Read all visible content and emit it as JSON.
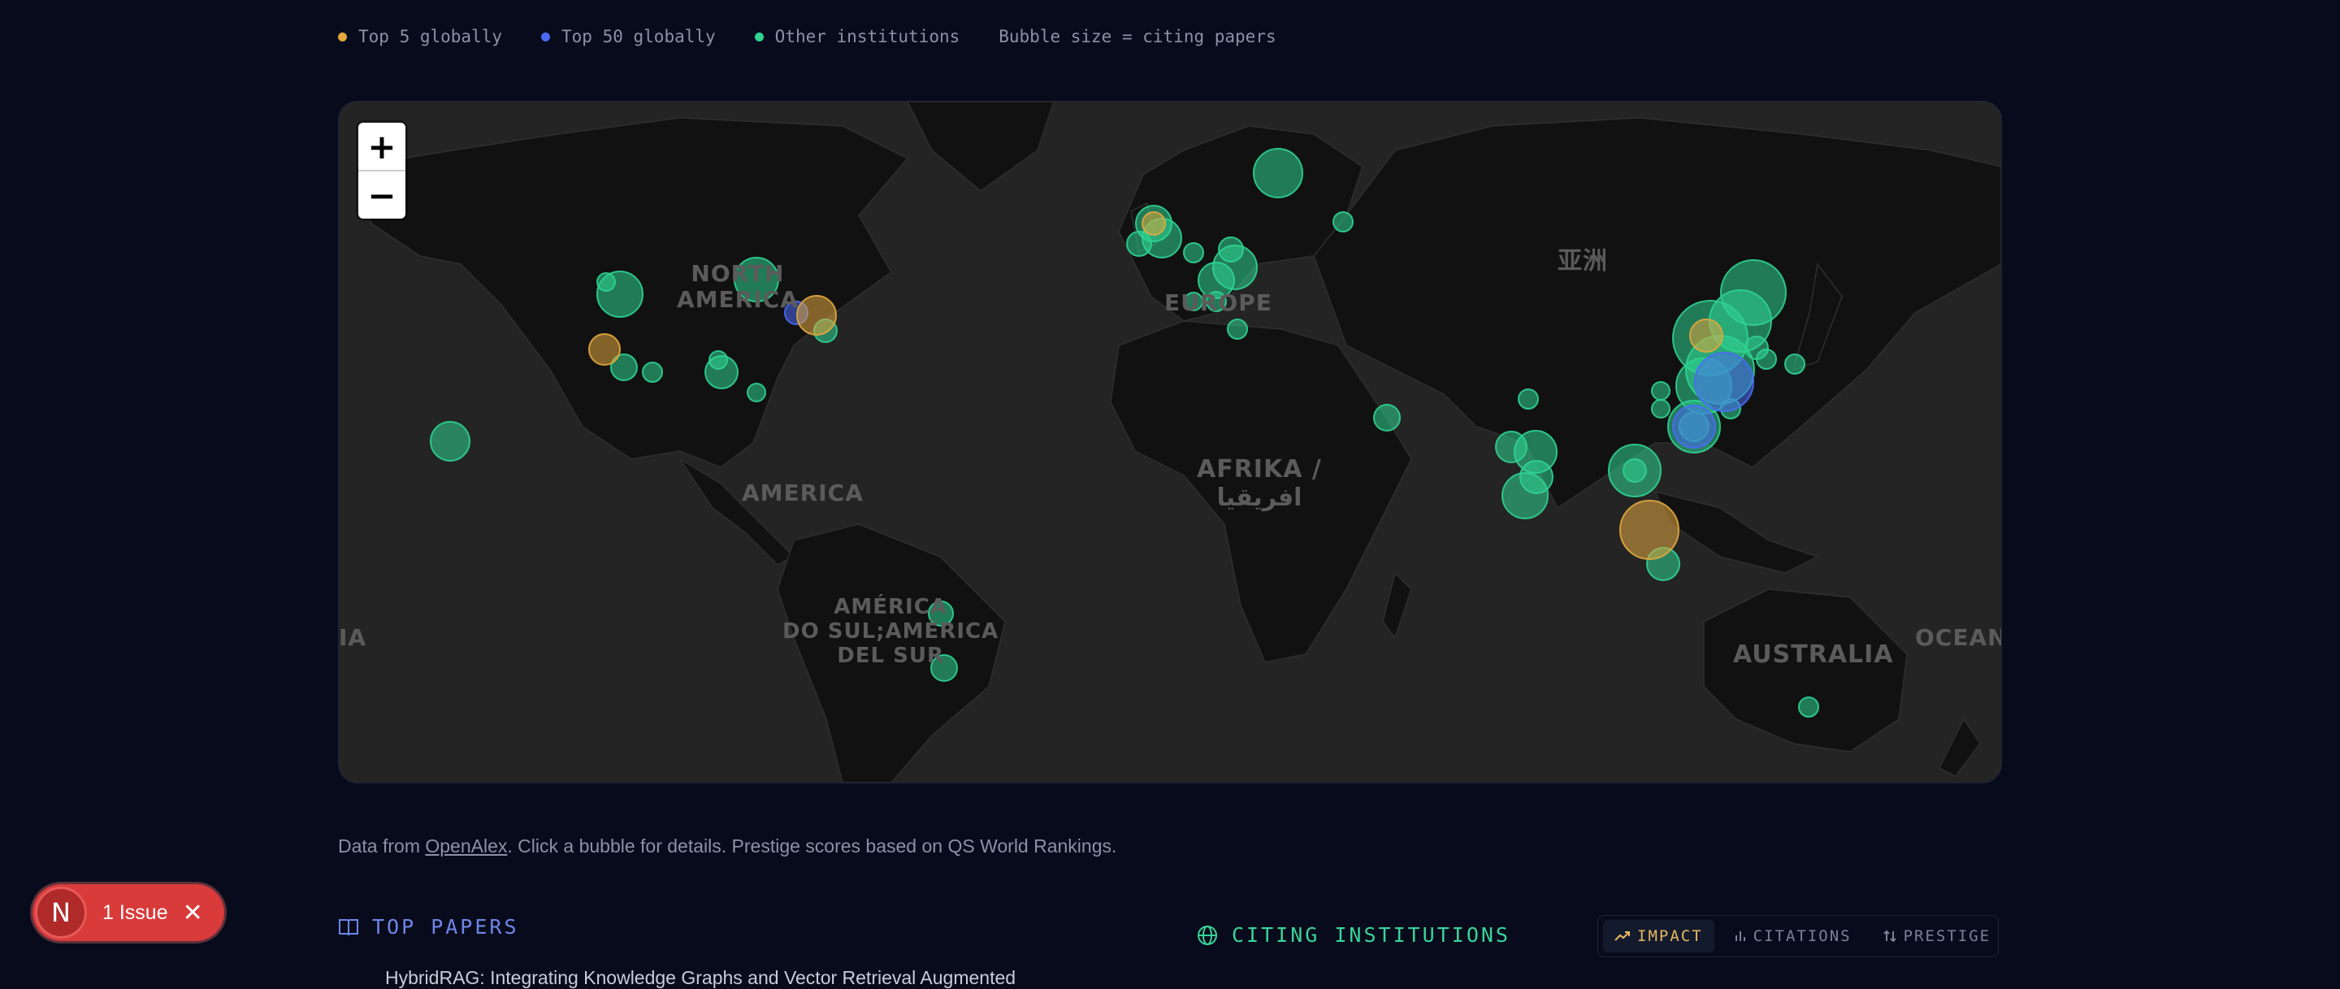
{
  "legend": {
    "items": [
      {
        "label": "Top 5 globally",
        "color": "#e2a83e"
      },
      {
        "label": "Top 50 globally",
        "color": "#4a6cf5"
      },
      {
        "label": "Other institutions",
        "color": "#2fd392"
      }
    ],
    "note": "Bubble size = citing papers"
  },
  "map": {
    "zoom_in": "+",
    "zoom_out": "−",
    "labels": {
      "north_america": "NORTH\nAMERICA",
      "america": "AMERICA",
      "south_america": "AMÉRICA\nDO SUL;AMÉRICA\nDEL SUR",
      "europe": "EUROPE",
      "africa": "AFRIKA /\nافريقيا",
      "asia": "亚洲",
      "australia": "AUSTRALIA",
      "oceania_right": "OCEAN",
      "oceania_left": "IA"
    }
  },
  "data_note": {
    "prefix": "Data from ",
    "link": "OpenAlex",
    "suffix": ". Click a bubble for details. Prestige scores based on QS World Rankings."
  },
  "top_papers": {
    "title": "TOP PAPERS",
    "first_paper_partial": "HybridRAG: Integrating Knowledge Graphs and Vector Retrieval Augmented"
  },
  "citing_institutions": {
    "title": "CITING INSTITUTIONS",
    "tabs": [
      "IMPACT",
      "CITATIONS",
      "PRESTIGE"
    ]
  },
  "issue_badge": {
    "logo": "N",
    "text": "1 Issue",
    "close": "✕"
  },
  "colors": {
    "top5": "#e2a83e",
    "top50": "#4a6cf5",
    "other": "#2fd392",
    "accent_blue": "#6f86e8",
    "accent_green": "#38d49a"
  }
}
